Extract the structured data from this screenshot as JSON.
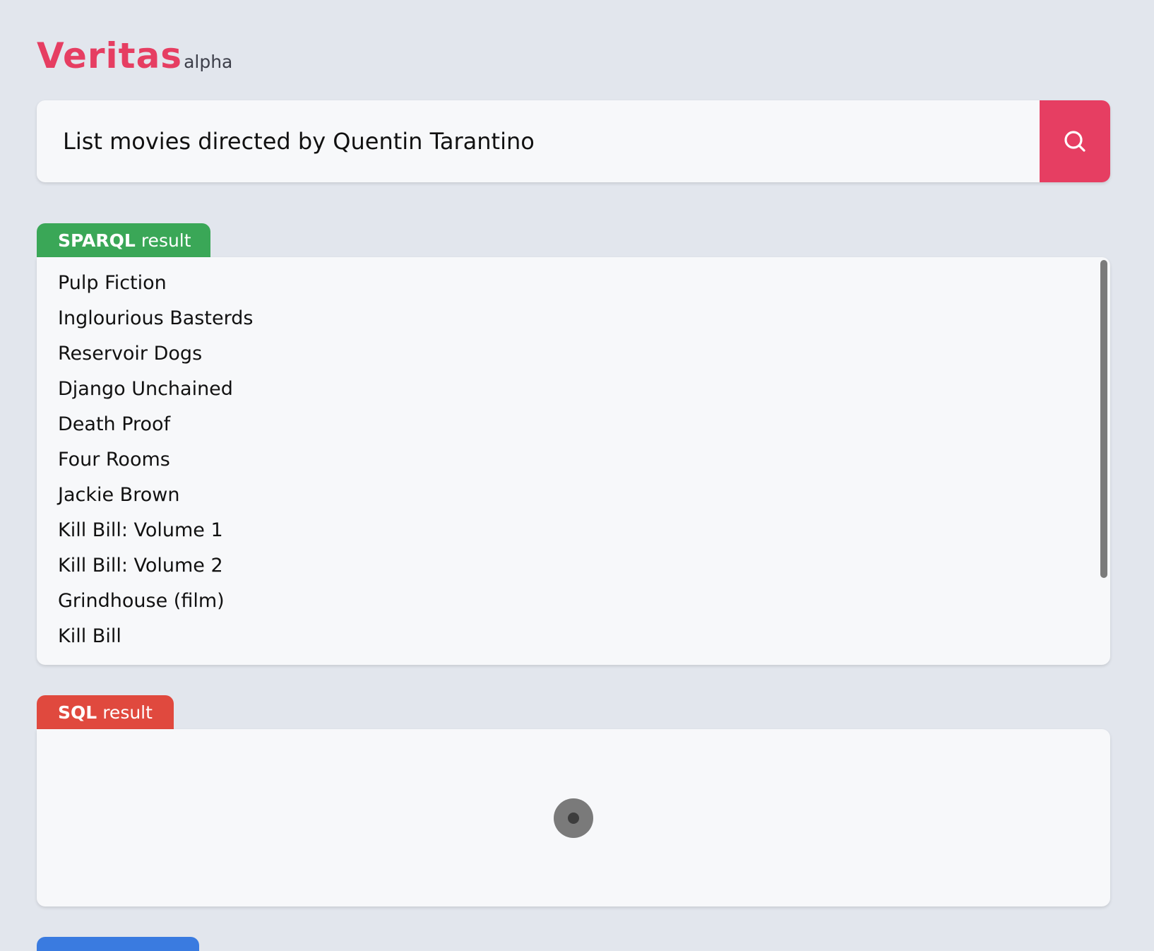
{
  "app": {
    "name": "Veritas",
    "tag": "alpha"
  },
  "search": {
    "value": "List movies directed by Quentin Tarantino",
    "button_icon": "search-icon"
  },
  "sparql": {
    "tab_bold": "SPARQL",
    "tab_rest": "result",
    "results": [
      "Pulp Fiction",
      "Inglourious Basterds",
      "Reservoir Dogs",
      "Django Unchained",
      "Death Proof",
      "Four Rooms",
      "Jackie Brown",
      "Kill Bill: Volume 1",
      "Kill Bill: Volume 2",
      "Grindhouse (film)",
      "Kill Bill"
    ]
  },
  "sql": {
    "tab_bold": "SQL",
    "tab_rest": "result",
    "status": "loading"
  },
  "colors": {
    "brand": "#e63e62",
    "sparql_tab": "#3aa757",
    "sql_tab": "#e0493e",
    "third_tab": "#3a7be0",
    "background": "#e2e6ed",
    "panel": "#f7f8fa"
  }
}
